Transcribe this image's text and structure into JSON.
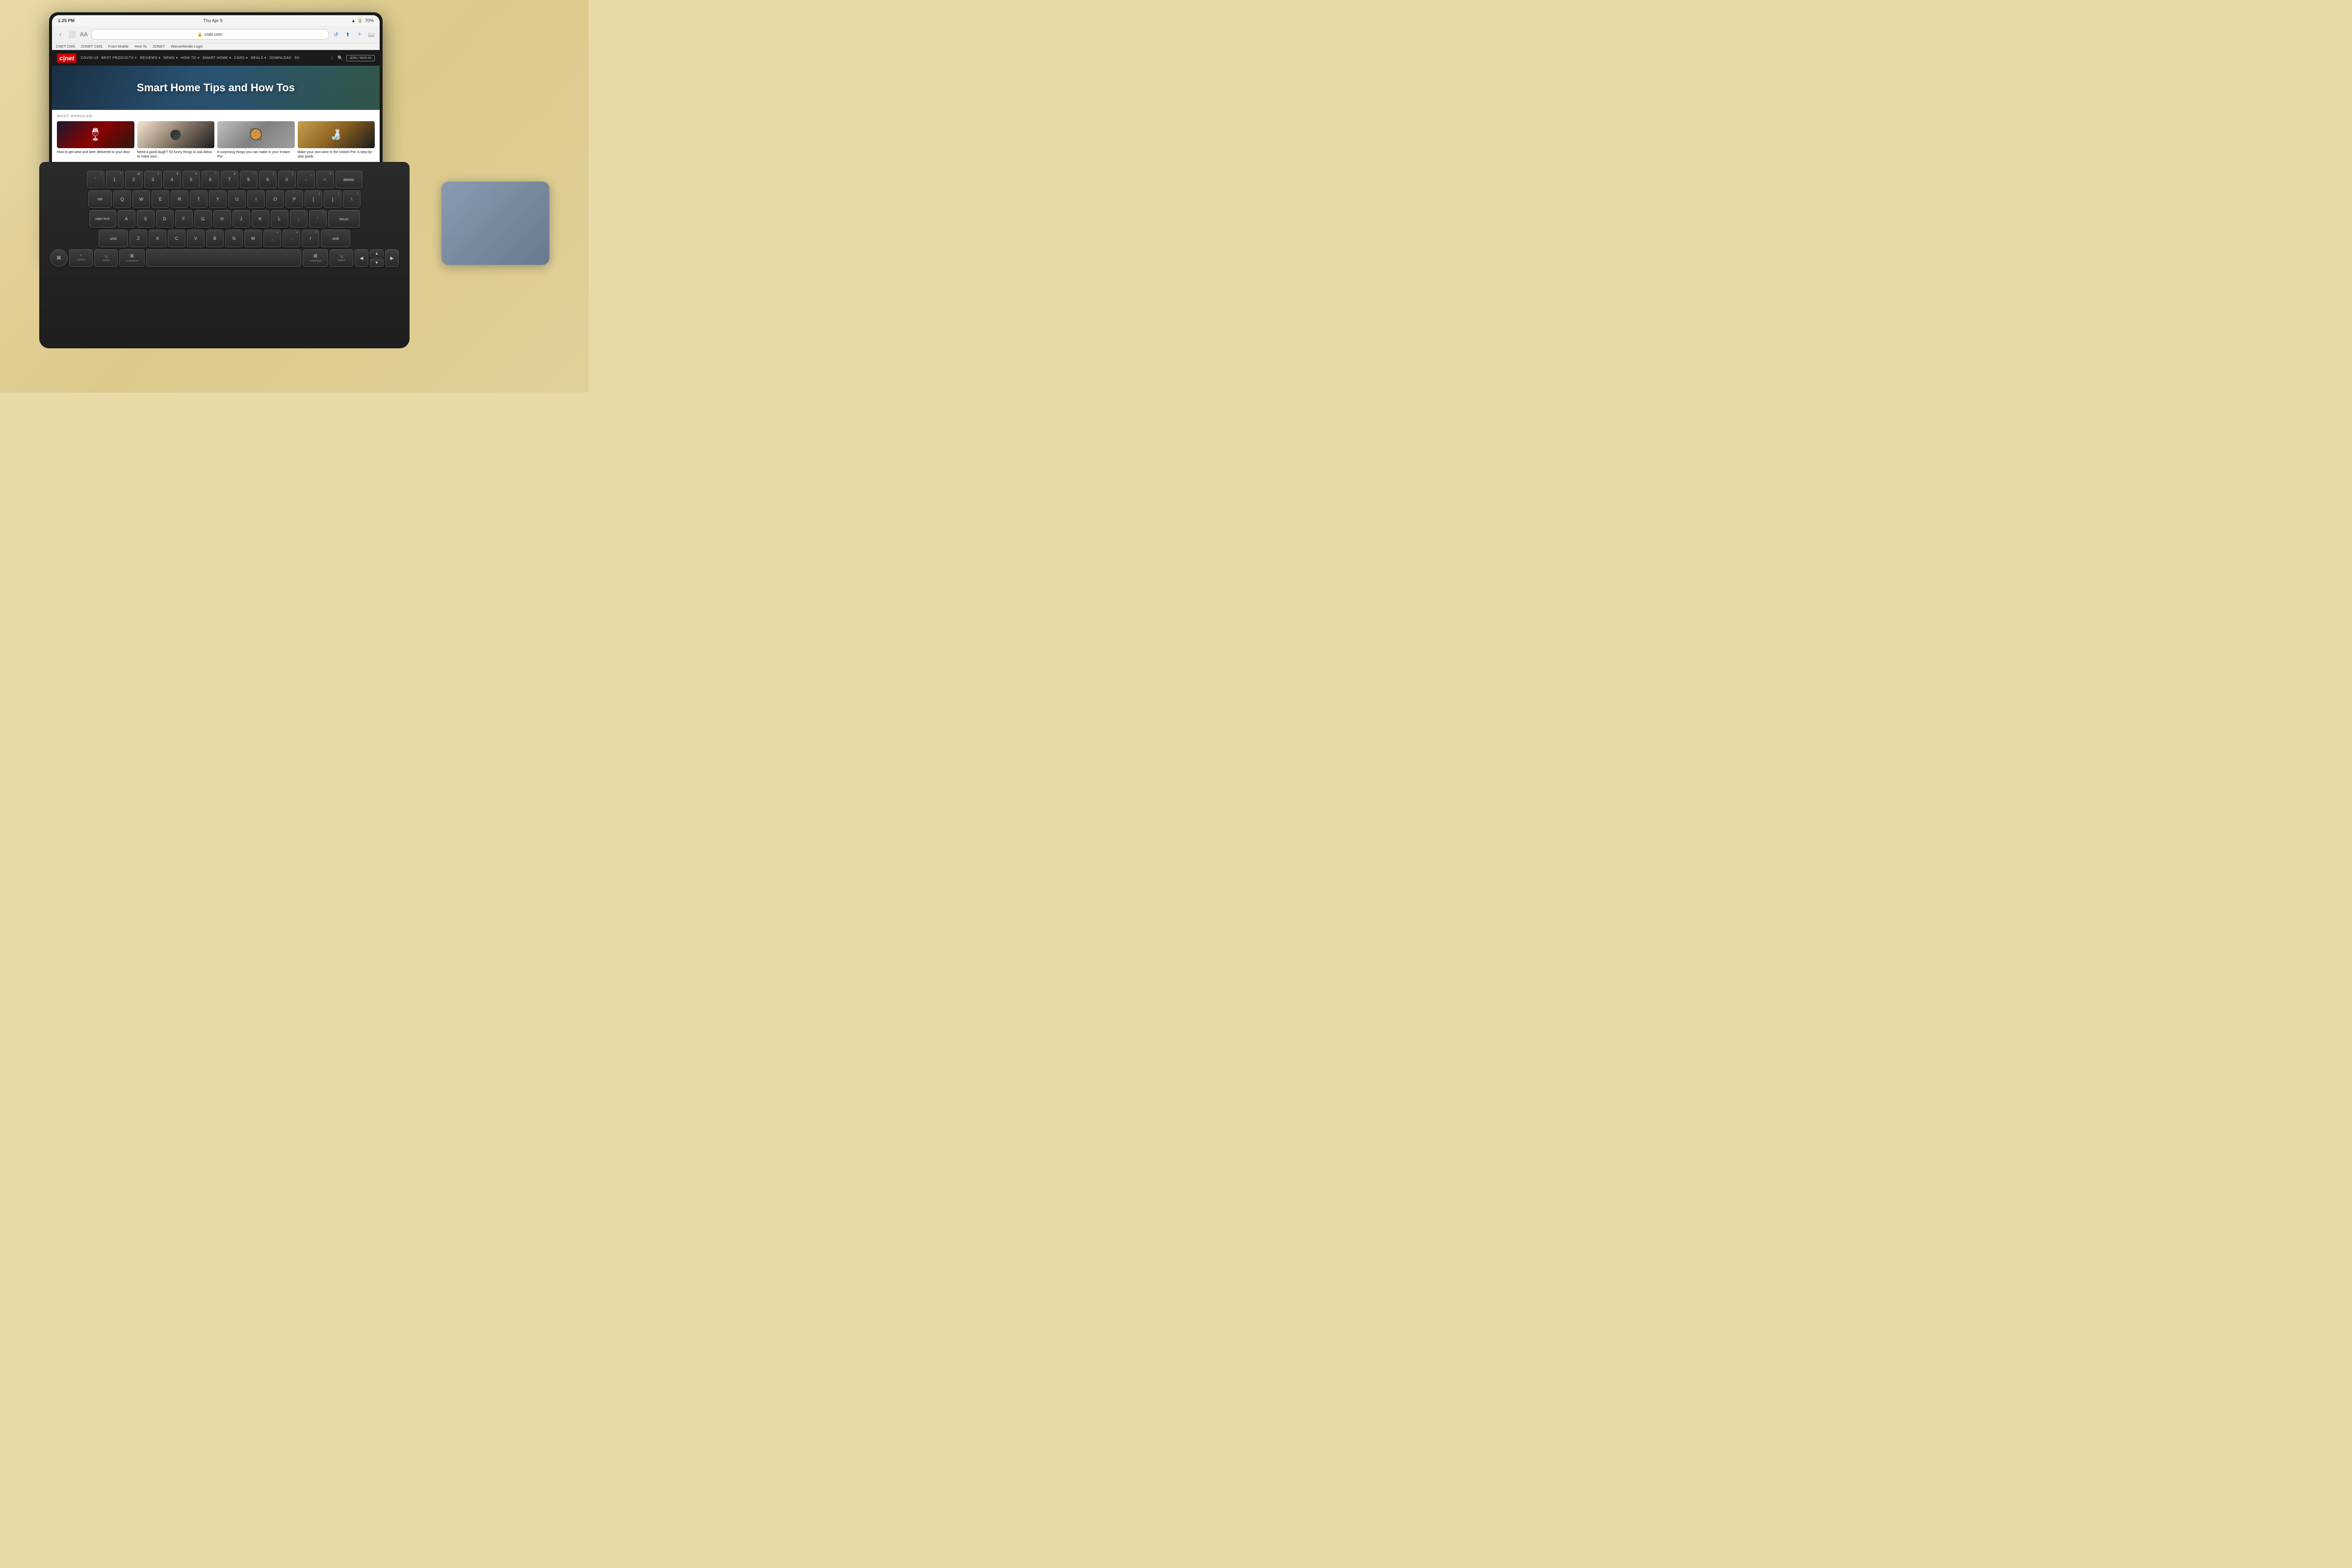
{
  "desk": {
    "background_color": "#e8d9a8"
  },
  "ipad": {
    "status_bar": {
      "time": "1:25 PM",
      "date": "Thu Apr 9",
      "battery": "70%",
      "wifi": true
    },
    "browser": {
      "url": "cnet.com",
      "bookmarks": [
        "CNET CMS",
        "ZDNET CMS",
        "From Mobile",
        "How To",
        "ZDNET",
        "WarnerMedia Login"
      ]
    },
    "website": {
      "name": "CNET",
      "logo": "cnet",
      "nav_items": [
        "COVID-19",
        "BEST PRODUCTS",
        "REVIEWS",
        "NEWS",
        "HOW TO",
        "SMART HOME",
        "CARS",
        "DEALS",
        "DOWNLOAD",
        "5G"
      ],
      "hero_title": "Smart Home Tips and How Tos",
      "section_label": "MOST POPULAR",
      "articles": [
        {
          "title": "How to get wine and beer delivered to your door",
          "image_type": "wine-glass"
        },
        {
          "title": "Need a good laugh? 53 funny things to ask Alexa to make your...",
          "image_type": "alexa"
        },
        {
          "title": "6 surprising things you can make in your Instant Pot",
          "image_type": "instapot"
        },
        {
          "title": "Make your own wine in the Instant Pot: A step-by-step guide",
          "image_type": "wine2"
        }
      ]
    }
  },
  "keyboard": {
    "rows": [
      {
        "keys": [
          {
            "label": "~\n`",
            "sub": "~",
            "main": "`"
          },
          {
            "label": "!\n1",
            "sub": "!",
            "main": "1"
          },
          {
            "label": "@\n2",
            "sub": "@",
            "main": "2"
          },
          {
            "label": "#\n3",
            "sub": "#",
            "main": "3"
          },
          {
            "label": "$\n4",
            "sub": "$",
            "main": "4"
          },
          {
            "label": "%\n5",
            "sub": "%",
            "main": "5"
          },
          {
            "label": "^\n6",
            "sub": "^",
            "main": "6"
          },
          {
            "label": "&\n7",
            "sub": "&",
            "main": "7"
          },
          {
            "label": "*\n8",
            "sub": "*",
            "main": "8"
          },
          {
            "label": "(\n9",
            "sub": "(",
            "main": "9"
          },
          {
            "label": ")\n0",
            "sub": ")",
            "main": "0"
          },
          {
            "label": "_\n-",
            "sub": "_",
            "main": "-"
          },
          {
            "label": "+\n=",
            "sub": "+",
            "main": "="
          },
          {
            "label": "delete",
            "wide": true
          }
        ]
      }
    ],
    "modifier_row": {
      "globe": "⌘",
      "control": "control",
      "option": "option",
      "command": "command",
      "space": "",
      "command_r": "command",
      "option_r": "option",
      "arrow_left": "◀",
      "arrow_up": "▲",
      "arrow_down": "▼",
      "arrow_right": "▶"
    }
  },
  "trackpad": {
    "color": "#8a9ab0"
  }
}
